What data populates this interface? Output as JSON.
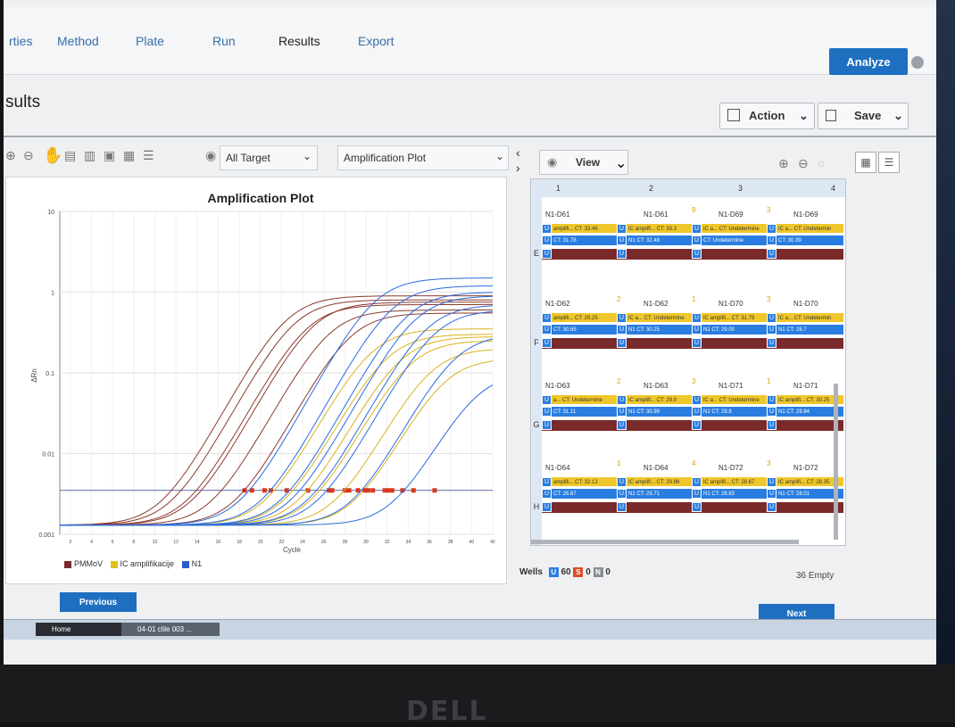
{
  "nav": {
    "tabs": [
      "rties",
      "Method",
      "Plate",
      "Run",
      "Results",
      "Export"
    ],
    "active_tab": "Results",
    "analyze_label": "Analyze"
  },
  "header": {
    "title": "sults",
    "action_label": "Action",
    "save_label": "Save"
  },
  "toolbar": {
    "target_select": "All Target",
    "plot_select": "Amplification Plot",
    "view_label": "View"
  },
  "chart_data": {
    "type": "line",
    "title": "Amplification Plot",
    "xlabel": "Cycle",
    "ylabel": "ΔRn",
    "yscale": "log",
    "ylim": [
      0.001,
      10
    ],
    "yticks": [
      "10",
      "1",
      "0.1",
      "0.01",
      "0.001"
    ],
    "xticks": [
      2,
      4,
      6,
      8,
      10,
      12,
      14,
      16,
      18,
      20,
      22,
      24,
      26,
      28,
      30,
      32,
      34,
      36,
      38,
      40,
      42
    ],
    "legend": [
      "PMMoV",
      "IC amplifikacije",
      "N1"
    ],
    "legend_colors": [
      "#7a2a2a",
      "#e0c020",
      "#2a5ed0"
    ],
    "legend_position": "bottom",
    "series": [
      {
        "name": "PMMoV",
        "color": "#8b3a2e",
        "curves": [
          {
            "ct": 18.5,
            "plateau": 0.9
          },
          {
            "ct": 19.2,
            "plateau": 0.8
          },
          {
            "ct": 20.4,
            "plateau": 0.7
          },
          {
            "ct": 21.0,
            "plateau": 0.75
          },
          {
            "ct": 22.5,
            "plateau": 0.6
          },
          {
            "ct": 24.5,
            "plateau": 0.55
          }
        ]
      },
      {
        "name": "IC amplifikacije",
        "color": "#d9b21c",
        "curves": [
          {
            "ct": 26.5,
            "plateau": 0.35
          },
          {
            "ct": 28.0,
            "plateau": 0.3
          },
          {
            "ct": 29.25,
            "plateau": 0.28
          },
          {
            "ct": 30.2,
            "plateau": 0.25
          },
          {
            "ct": 32.12,
            "plateau": 0.2
          },
          {
            "ct": 33.46,
            "plateau": 0.15
          }
        ]
      },
      {
        "name": "N1",
        "color": "#2a6ae0",
        "curves": [
          {
            "ct": 26.8,
            "plateau": 1.5
          },
          {
            "ct": 28.4,
            "plateau": 1.2
          },
          {
            "ct": 29.9,
            "plateau": 1.0
          },
          {
            "ct": 30.65,
            "plateau": 0.9
          },
          {
            "ct": 31.78,
            "plateau": 0.7
          },
          {
            "ct": 32.48,
            "plateau": 0.6
          },
          {
            "ct": 34.5,
            "plateau": 0.3
          },
          {
            "ct": 36.5,
            "plateau": 0.1
          }
        ]
      }
    ]
  },
  "plate": {
    "columns": [
      "1",
      "2",
      "3",
      "4"
    ],
    "rows": [
      "E",
      "F",
      "G",
      "H"
    ],
    "wells": [
      {
        "row": 0,
        "col": 0,
        "name": "N1-D61",
        "y": "amplifi... CT: 33.46",
        "b": "CT: 31.78",
        "warn": ""
      },
      {
        "row": 0,
        "col": 1,
        "name": "N1-D61",
        "y": "IC amplifi... CT: 33.3",
        "b": "N1  CT: 32.48",
        "warn": ""
      },
      {
        "row": 0,
        "col": 2,
        "name": "N1-D69",
        "y": "IC a... CT: Undetermine",
        "b": "CT: Undetermine",
        "warn": "9"
      },
      {
        "row": 0,
        "col": 3,
        "name": "N1-D69",
        "y": "IC a... CT: Undetermin",
        "b": "CT: 30.39",
        "warn": "3"
      },
      {
        "row": 1,
        "col": 0,
        "name": "N1-D62",
        "y": "amplifi... CT: 29.25",
        "b": "CT: 30.65",
        "warn": ""
      },
      {
        "row": 1,
        "col": 1,
        "name": "N1-D62",
        "y": "IC a... CT: Undetermine",
        "b": "N1  CT: 30.25",
        "warn": "2"
      },
      {
        "row": 1,
        "col": 2,
        "name": "N1-D70",
        "y": "IC amplifi... CT: 31.79",
        "b": "N1  CT: 29.00",
        "warn": "1"
      },
      {
        "row": 1,
        "col": 3,
        "name": "N1-D70",
        "y": "IC a... CT: Undetermin",
        "b": "N1  CT: 28.7",
        "warn": "3"
      },
      {
        "row": 2,
        "col": 0,
        "name": "N1-D63",
        "y": "a... CT: Undetermine",
        "b": "CT: 31.11",
        "warn": ""
      },
      {
        "row": 2,
        "col": 1,
        "name": "N1-D63",
        "y": "IC amplifi... CT: 29.9",
        "b": "N1  CT: 30.99",
        "warn": "2"
      },
      {
        "row": 2,
        "col": 2,
        "name": "N1-D71",
        "y": "IC a... CT: Undetermine",
        "b": "N1  CT: 29.8",
        "warn": "3"
      },
      {
        "row": 2,
        "col": 3,
        "name": "N1-D71",
        "y": "IC amplifi... CT: 30.25",
        "b": "N1  CT: 29.84",
        "warn": "1"
      },
      {
        "row": 3,
        "col": 0,
        "name": "N1-D64",
        "y": "amplifi... CT: 32.12",
        "b": "CT: 26.87",
        "warn": ""
      },
      {
        "row": 3,
        "col": 1,
        "name": "N1-D64",
        "y": "IC amplifi... CT: 29.96",
        "b": "N1  CT: 29.71",
        "warn": "1"
      },
      {
        "row": 3,
        "col": 2,
        "name": "N1-D72",
        "y": "IC amplifi... CT: 28.67",
        "b": "N1  CT: 28.83",
        "warn": "4"
      },
      {
        "row": 3,
        "col": 3,
        "name": "N1-D72",
        "y": "IC amplifi... CT: 28.35",
        "b": "N1  CT: 28.01",
        "warn": "3"
      }
    ]
  },
  "footer": {
    "wells_label": "Wells",
    "wells_u": "60",
    "wells_s": "0",
    "wells_n": "0",
    "empty_label": "36 Empty",
    "previous_label": "Previous",
    "next_label": "Next",
    "taskbar": [
      "Home",
      "04-01 clile 003 ..."
    ]
  },
  "brand": "DELL",
  "colors": {
    "accent": "#1e6fc0",
    "pmmov": "#7a2a2a",
    "ic": "#e0c020",
    "n1": "#2a5ed0"
  }
}
